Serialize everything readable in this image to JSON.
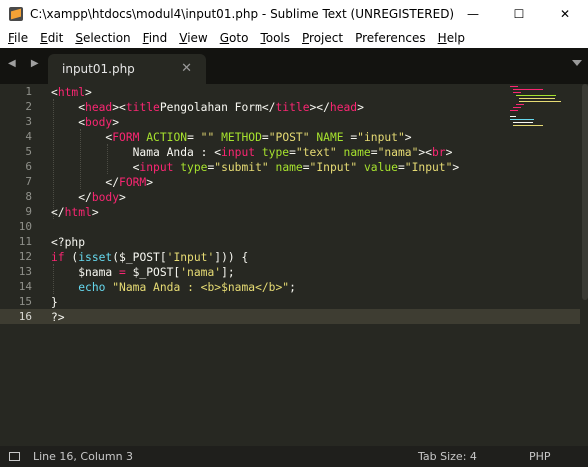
{
  "window": {
    "title": "C:\\xampp\\htdocs\\modul4\\input01.php - Sublime Text (UNREGISTERED)",
    "minimize": "—",
    "maximize": "☐",
    "close": "✕"
  },
  "menu": [
    {
      "u": "F",
      "rest": "ile"
    },
    {
      "u": "E",
      "rest": "dit"
    },
    {
      "u": "S",
      "rest": "election"
    },
    {
      "u": "F",
      "rest": "ind"
    },
    {
      "u": "V",
      "rest": "iew"
    },
    {
      "u": "G",
      "rest": "oto"
    },
    {
      "u": "T",
      "rest": "ools"
    },
    {
      "u": "P",
      "rest": "roject"
    },
    {
      "u": "",
      "rest": "Preferences"
    },
    {
      "u": "H",
      "rest": "elp"
    }
  ],
  "tabbar": {
    "nav": "◀ ▶",
    "tab_label": "input01.php",
    "tab_close": "✕"
  },
  "colors": {
    "background": "#272822",
    "tag": "#f92672",
    "attr": "#a6e22e",
    "string": "#e6db74",
    "text": "#f8f8f2",
    "builtin": "#66d9ef",
    "line_number": "#8f908a"
  },
  "editor": {
    "line_numbers": [
      "1",
      "2",
      "3",
      "4",
      "5",
      "6",
      "7",
      "8",
      "9",
      "10",
      "11",
      "12",
      "13",
      "14",
      "15",
      "16"
    ],
    "active_line": 16,
    "lines": [
      [
        [
          "t",
          "<"
        ],
        [
          "g",
          "html"
        ],
        [
          "t",
          ">"
        ]
      ],
      [
        [
          "t",
          "    <"
        ],
        [
          "g",
          "head"
        ],
        [
          "t",
          "><"
        ],
        [
          "g",
          "title"
        ],
        [
          "t",
          "Pengolahan Form</"
        ],
        [
          "g",
          "title"
        ],
        [
          "t",
          "></"
        ],
        [
          "g",
          "head"
        ],
        [
          "t",
          ">"
        ]
      ],
      [
        [
          "t",
          "    <"
        ],
        [
          "g",
          "body"
        ],
        [
          "t",
          ">"
        ]
      ],
      [
        [
          "t",
          "        <"
        ],
        [
          "g",
          "FORM"
        ],
        [
          "t",
          " "
        ],
        [
          "a",
          "ACTION"
        ],
        [
          "t",
          "= "
        ],
        [
          "s",
          "\"\""
        ],
        [
          "t",
          " "
        ],
        [
          "a",
          "METHOD"
        ],
        [
          "t",
          "="
        ],
        [
          "s",
          "\"POST\""
        ],
        [
          "t",
          " "
        ],
        [
          "a",
          "NAME"
        ],
        [
          "t",
          " ="
        ],
        [
          "s",
          "\"input\""
        ],
        [
          "t",
          ">"
        ]
      ],
      [
        [
          "t",
          "            Nama Anda : <"
        ],
        [
          "g",
          "input"
        ],
        [
          "t",
          " "
        ],
        [
          "a",
          "type"
        ],
        [
          "t",
          "="
        ],
        [
          "s",
          "\"text\""
        ],
        [
          "t",
          " "
        ],
        [
          "a",
          "name"
        ],
        [
          "t",
          "="
        ],
        [
          "s",
          "\"nama\""
        ],
        [
          "t",
          "><"
        ],
        [
          "g",
          "br"
        ],
        [
          "t",
          ">"
        ]
      ],
      [
        [
          "t",
          "            <"
        ],
        [
          "g",
          "input"
        ],
        [
          "t",
          " "
        ],
        [
          "a",
          "type"
        ],
        [
          "t",
          "="
        ],
        [
          "s",
          "\"submit\""
        ],
        [
          "t",
          " "
        ],
        [
          "a",
          "name"
        ],
        [
          "t",
          "="
        ],
        [
          "s",
          "\"Input\""
        ],
        [
          "t",
          " "
        ],
        [
          "a",
          "value"
        ],
        [
          "t",
          "="
        ],
        [
          "s",
          "\"Input\""
        ],
        [
          "t",
          ">"
        ]
      ],
      [
        [
          "t",
          "        </"
        ],
        [
          "g",
          "FORM"
        ],
        [
          "t",
          ">"
        ]
      ],
      [
        [
          "t",
          "    </"
        ],
        [
          "g",
          "body"
        ],
        [
          "t",
          ">"
        ]
      ],
      [
        [
          "t",
          "</"
        ],
        [
          "g",
          "html"
        ],
        [
          "t",
          ">"
        ]
      ],
      [
        [
          "t",
          ""
        ]
      ],
      [
        [
          "t",
          "<?php"
        ]
      ],
      [
        [
          "g",
          "if"
        ],
        [
          "t",
          " ("
        ],
        [
          "b",
          "isset"
        ],
        [
          "t",
          "($_POST["
        ],
        [
          "s",
          "'Input'"
        ],
        [
          "t",
          "])) {"
        ]
      ],
      [
        [
          "t",
          "    $nama "
        ],
        [
          "g",
          "="
        ],
        [
          "t",
          " $_POST["
        ],
        [
          "s",
          "'nama'"
        ],
        [
          "t",
          "];"
        ]
      ],
      [
        [
          "t",
          "    "
        ],
        [
          "b",
          "echo"
        ],
        [
          "t",
          " "
        ],
        [
          "s",
          "\"Nama Anda : <b>$nama</b>\""
        ],
        [
          "t",
          ";"
        ]
      ],
      [
        [
          "t",
          "}"
        ]
      ],
      [
        [
          "t",
          "?>"
        ]
      ]
    ]
  },
  "status": {
    "position": "Line 16, Column 3",
    "tab_size": "Tab Size: 4",
    "syntax": "PHP"
  }
}
